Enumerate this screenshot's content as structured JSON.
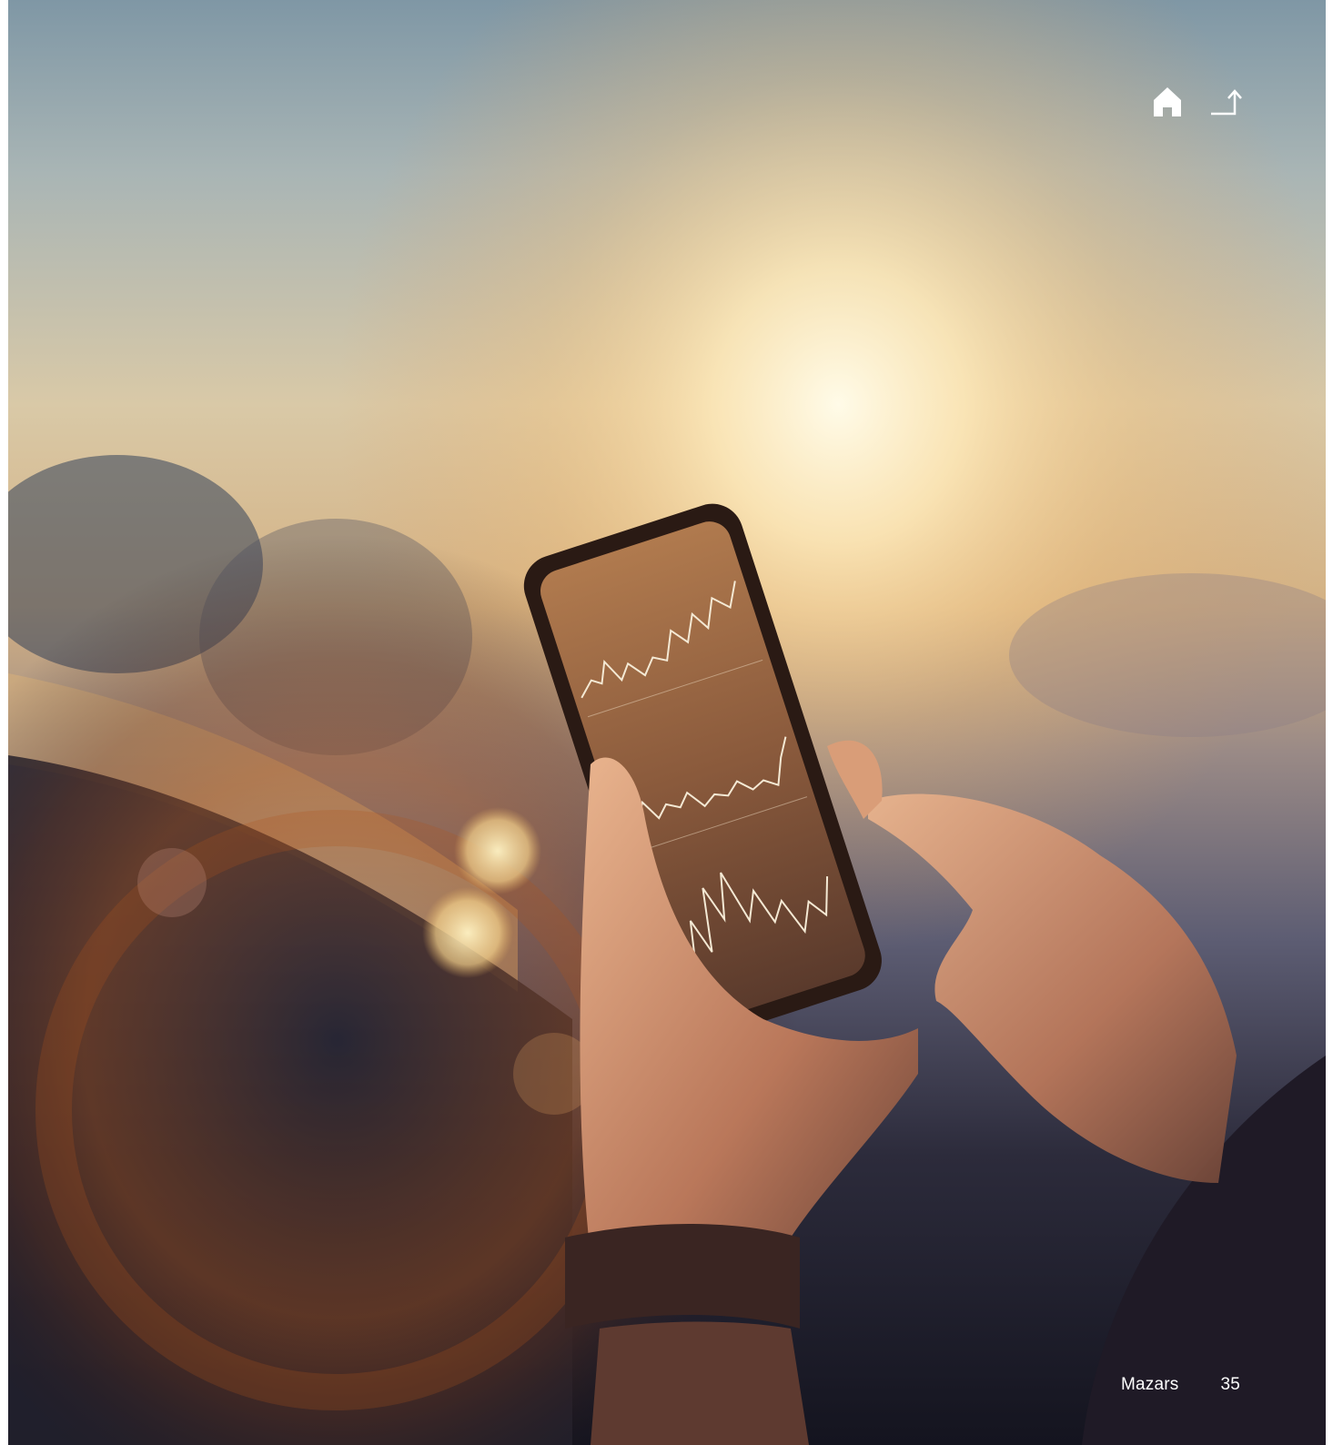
{
  "navigation": {
    "home_icon": "home-icon",
    "exit_icon": "exit-arrow-icon"
  },
  "footer": {
    "brand": "Mazars",
    "page_number": "35"
  },
  "colors": {
    "sky_top": "#8aa0ab",
    "sun_glow": "#fff4d2",
    "haze": "#d8b48a",
    "dark_lower": "#1a1c2a",
    "phone_screen": "#6b4632",
    "text": "#ffffff"
  }
}
